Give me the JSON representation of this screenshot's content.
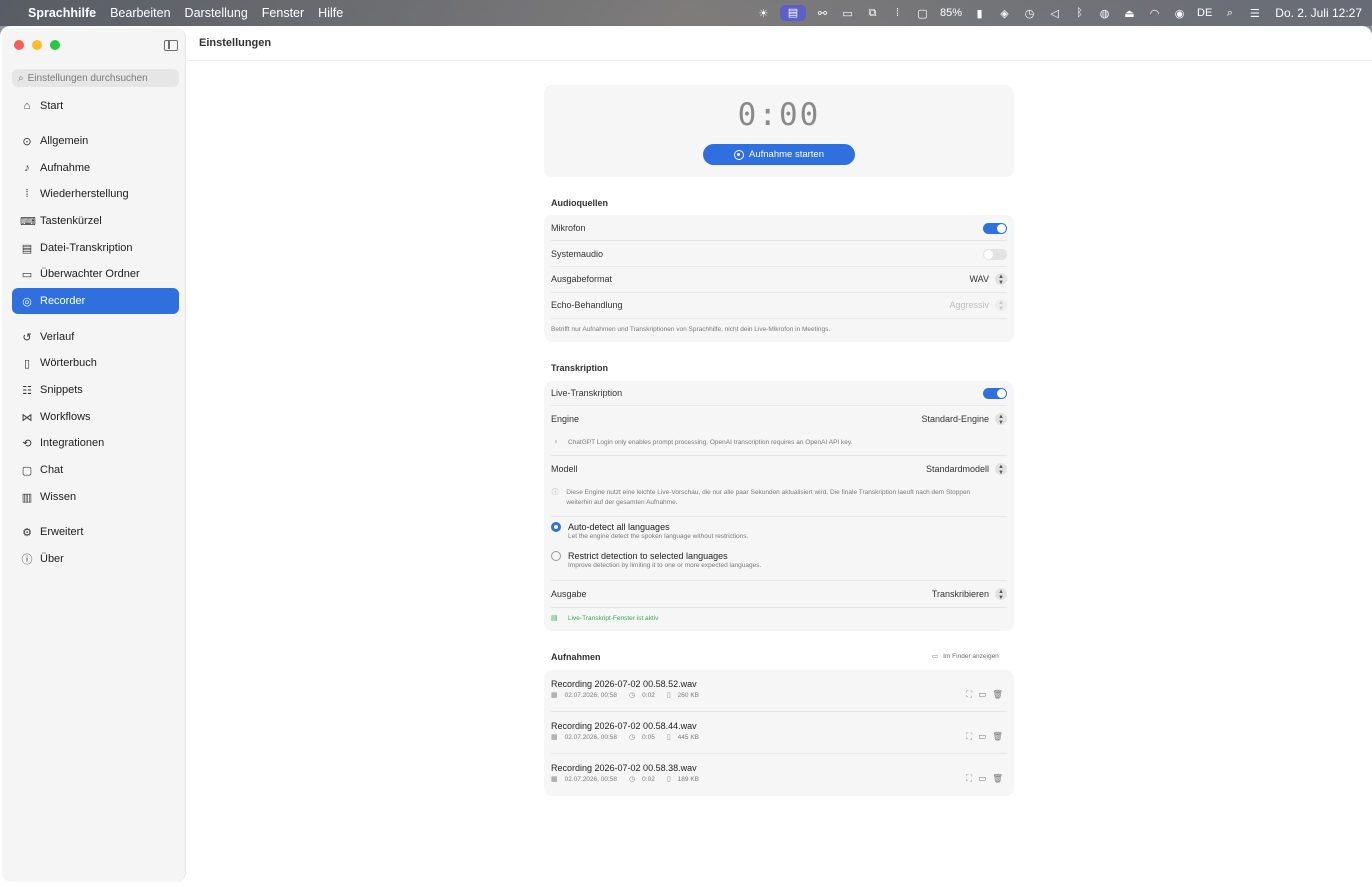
{
  "menubar": {
    "app_name": "Sprachhilfe",
    "menus": [
      "Bearbeiten",
      "Darstellung",
      "Fenster",
      "Hilfe"
    ],
    "battery": "85%",
    "input_source": "DE",
    "clock": "Do. 2. Juli  12:27"
  },
  "window": {
    "title": "Einstellungen"
  },
  "sidebar": {
    "search_placeholder": "Einstellungen durchsuchen",
    "items": [
      {
        "label": "Start",
        "icon": "house-icon"
      },
      {
        "label": "Allgemein",
        "icon": "play-circle-icon"
      },
      {
        "label": "Aufnahme",
        "icon": "microphone-icon"
      },
      {
        "label": "Wiederherstellung",
        "icon": "waveform-icon"
      },
      {
        "label": "Tastenkürzel",
        "icon": "keyboard-icon"
      },
      {
        "label": "Datei-Transkription",
        "icon": "document-icon"
      },
      {
        "label": "Überwachter Ordner",
        "icon": "folder-icon"
      },
      {
        "label": "Recorder",
        "icon": "record-icon"
      },
      {
        "label": "Verlauf",
        "icon": "history-icon"
      },
      {
        "label": "Wörterbuch",
        "icon": "book-icon"
      },
      {
        "label": "Snippets",
        "icon": "snippets-icon"
      },
      {
        "label": "Workflows",
        "icon": "workflow-icon"
      },
      {
        "label": "Integrationen",
        "icon": "integration-icon"
      },
      {
        "label": "Chat",
        "icon": "chat-icon"
      },
      {
        "label": "Wissen",
        "icon": "library-icon"
      },
      {
        "label": "Erweitert",
        "icon": "gears-icon"
      },
      {
        "label": "Über",
        "icon": "info-icon"
      }
    ],
    "active_item": "Recorder"
  },
  "recorder": {
    "timer": "0:00",
    "start_button": "Aufnahme starten"
  },
  "audio_sources": {
    "title": "Audioquellen",
    "mikrofon_label": "Mikrofon",
    "mikrofon_on": true,
    "systemaudio_label": "Systemaudio",
    "systemaudio_on": false,
    "format_label": "Ausgabeformat",
    "format_value": "WAV",
    "echo_label": "Echo-Behandlung",
    "echo_value": "Aggressiv",
    "note": "Betrifft nur Aufnahmen und Transkriptionen von Sprachhilfe, nicht dein Live-Mikrofon in Meetings."
  },
  "transcription": {
    "title": "Transkription",
    "live_label": "Live-Transkription",
    "live_on": true,
    "engine_label": "Engine",
    "engine_value": "Standard-Engine",
    "engine_hint": "ChatGPT Login only enables prompt processing. OpenAI transcription requires an OpenAI API key.",
    "model_label": "Modell",
    "model_value": "Standardmodell",
    "model_hint": "Diese Engine nutzt eine leichte Live-Vorschau, die nur alle paar Sekunden aktualisiert wird. Die finale Transkription laeuft nach dem Stoppen weiterhin auf der gesamten Aufnahme.",
    "radio_auto_title": "Auto-detect all languages",
    "radio_auto_desc": "Let the engine detect the spoken language without restrictions.",
    "radio_restrict_title": "Restrict detection to selected languages",
    "radio_restrict_desc": "Improve detection by limiting it to one or more expected languages.",
    "selected_radio": "auto",
    "output_label": "Ausgabe",
    "output_value": "Transkribieren",
    "status": "Live-Transkript-Fenster ist aktiv"
  },
  "recordings": {
    "title": "Aufnahmen",
    "finder_link": "Im Finder anzeigen",
    "items": [
      {
        "name": "Recording 2026-07-02 00.58.52.wav",
        "date": "02.07.2026, 00:58",
        "duration": "0:02",
        "size": "260 KB"
      },
      {
        "name": "Recording 2026-07-02 00.58.44.wav",
        "date": "02.07.2026, 00:58",
        "duration": "0:05",
        "size": "445 KB"
      },
      {
        "name": "Recording 2026-07-02 00.58.38.wav",
        "date": "02.07.2026, 00:58",
        "duration": "0:02",
        "size": "189 KB"
      }
    ]
  },
  "colors": {
    "accent": "#2f6fde",
    "status_green": "#3aa757"
  }
}
